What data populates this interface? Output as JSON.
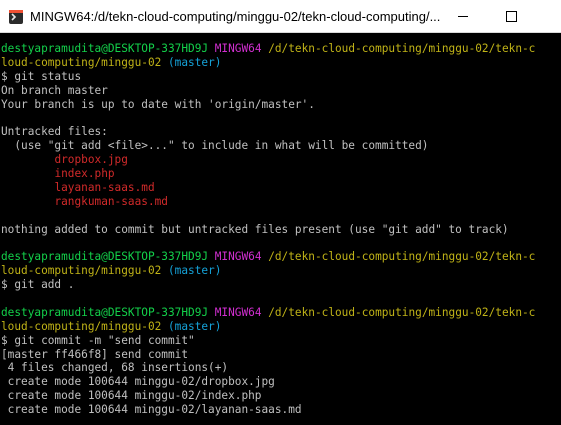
{
  "window": {
    "title": "MINGW64:/d/tekn-cloud-computing/minggu-02/tekn-cloud-computing/...",
    "icon": "git-bash-icon",
    "minimize_icon": "minimize-icon",
    "maximize_icon": "maximize-icon"
  },
  "colors": {
    "user_host": "#13d04a",
    "msystem": "#d12fd0",
    "path": "#c0b317",
    "branch": "#15a2d8",
    "untracked": "#d12a2a",
    "text": "#c0c0c0"
  },
  "prompt": {
    "user_host": "destyapramudita@DESKTOP-337HD9J",
    "msystem": "MINGW64",
    "path_line1": "/d/tekn-cloud-computing/minggu-02/tekn-c",
    "path_line2": "loud-computing/minggu-02",
    "branch": "(master)"
  },
  "session": {
    "cmd1": "$ git status",
    "status_branch": "On branch master",
    "status_uptodate": "Your branch is up to date with 'origin/master'.",
    "untracked_header": "Untracked files:",
    "untracked_hint": "  (use \"git add <file>...\" to include in what will be committed)",
    "untracked_files": [
      "dropbox.jpg",
      "index.php",
      "layanan-saas.md",
      "rangkuman-saas.md"
    ],
    "nothing_added": "nothing added to commit but untracked files present (use \"git add\" to track)",
    "cmd2": "$ git add .",
    "cmd3": "$ git commit -m \"send commit\"",
    "commit_result": "[master ff466f8] send commit",
    "commit_stats": " 4 files changed, 68 insertions(+)",
    "create1": " create mode 100644 minggu-02/dropbox.jpg",
    "create2": " create mode 100644 minggu-02/index.php",
    "create3": " create mode 100644 minggu-02/layanan-saas.md"
  }
}
